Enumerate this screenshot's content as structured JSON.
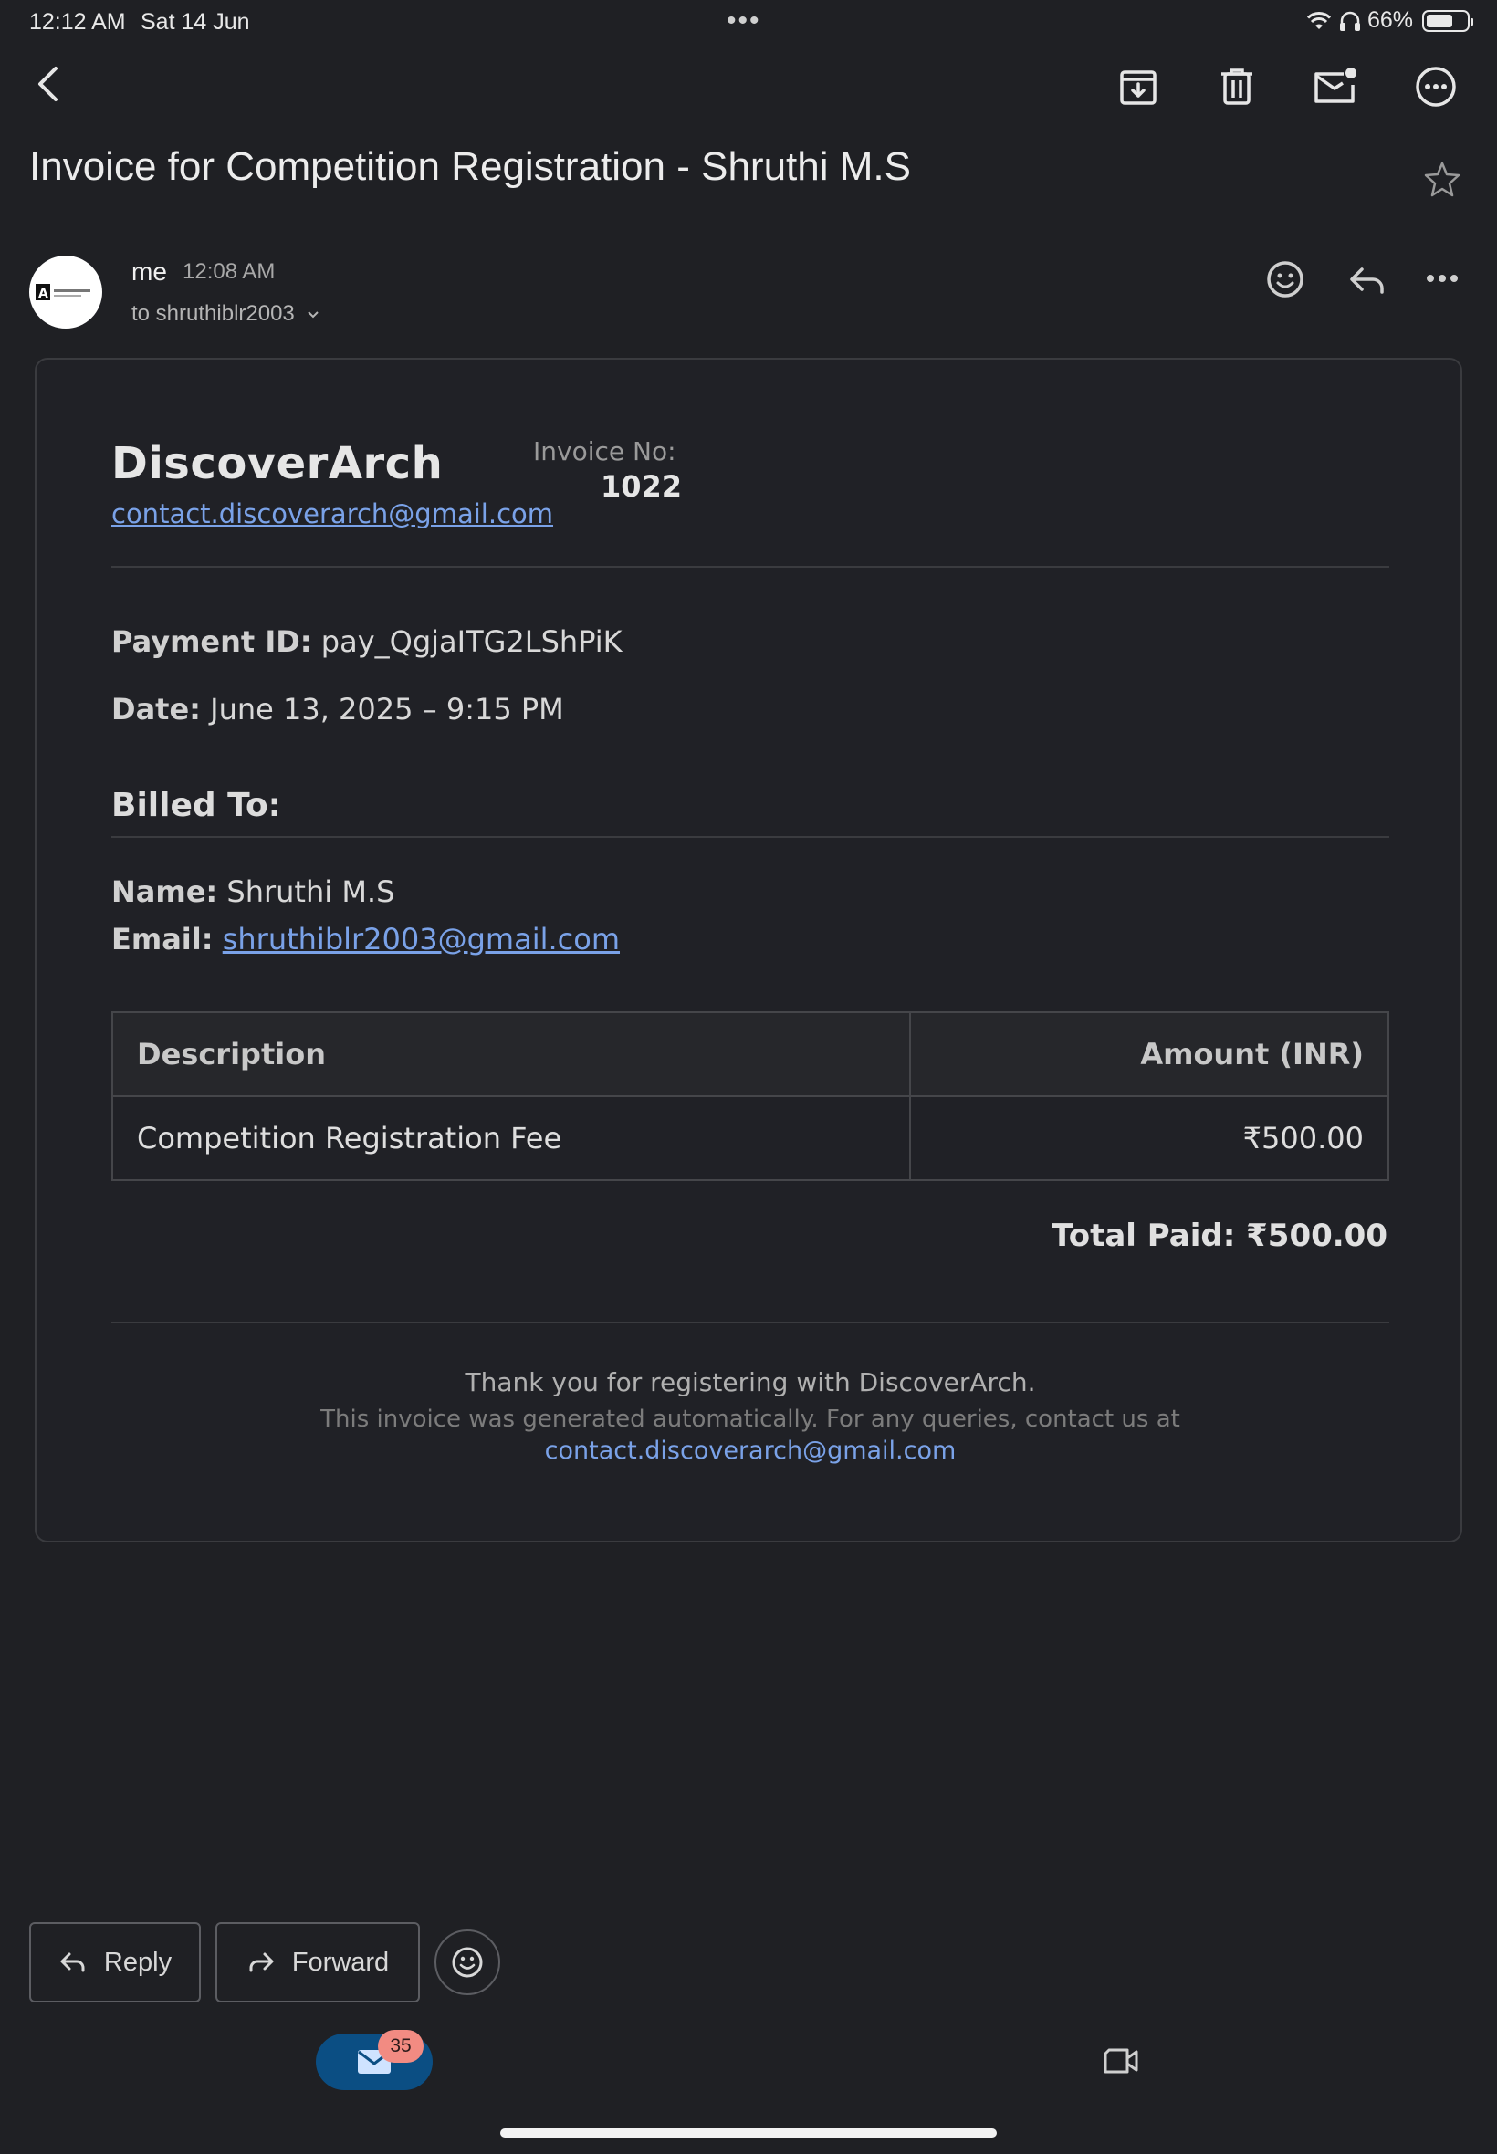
{
  "status_bar": {
    "time": "12:12 AM",
    "date": "Sat 14 Jun",
    "battery": "66%",
    "battery_level": 0.66
  },
  "toolbar": {
    "back_icon": "chevron-left-icon",
    "actions": [
      "archive-icon",
      "delete-icon",
      "mark-unread-icon",
      "more-options-icon"
    ]
  },
  "email": {
    "subject": "Invoice for Competition Registration - Shruthi M.S",
    "sender": "me",
    "time": "12:08 AM",
    "to": "to shruthiblr2003"
  },
  "invoice": {
    "brand": "DiscoverArch",
    "brand_email": "contact.discoverarch@gmail.com",
    "invoice_no_label": "Invoice No:",
    "invoice_no": "1022",
    "payment_id_label": "Payment ID:",
    "payment_id": "pay_QgjaITG2LShPiK",
    "date_label": "Date:",
    "date": "June 13, 2025 – 9:15 PM",
    "billed_to": "Billed To:",
    "name_label": "Name:",
    "name": "Shruthi M.S",
    "email_label": "Email:",
    "email": "shruthiblr2003@gmail.com",
    "table": {
      "headers": [
        "Description",
        "Amount (INR)"
      ],
      "rows": [
        [
          "Competition Registration Fee",
          "₹500.00"
        ]
      ]
    },
    "total": "Total Paid: ₹500.00",
    "thanks": "Thank you for registering with DiscoverArch.",
    "footer_note": "This invoice was generated automatically. For any queries, contact us at",
    "footer_email": "contact.discoverarch@gmail.com"
  },
  "actions": {
    "reply": "Reply",
    "forward": "Forward"
  },
  "bottom_nav": {
    "mail_badge": "35"
  },
  "colors": {
    "background": "#1f2024",
    "link": "#7aa2e8",
    "mail_pill": "#0b4e83",
    "badge": "#f28b82"
  }
}
